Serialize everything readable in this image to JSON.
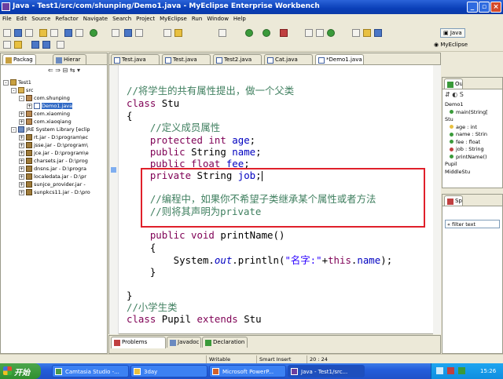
{
  "window": {
    "title": "Java - Test1/src/com/shunping/Demo1.java - MyEclipse Enterprise Workbench"
  },
  "menu": [
    "File",
    "Edit",
    "Source",
    "Refactor",
    "Navigate",
    "Search",
    "Project",
    "MyEclipse",
    "Run",
    "Window",
    "Help"
  ],
  "perspectives": {
    "java": "Java",
    "myeclipse": "MyEclipse"
  },
  "left_tabs": {
    "package": "Packag",
    "hierarchy": "Hierar"
  },
  "tree": [
    {
      "label": "Test1",
      "indent": 0,
      "twisty": "-",
      "icon": "proj"
    },
    {
      "label": "src",
      "indent": 1,
      "twisty": "-",
      "icon": "src"
    },
    {
      "label": "com.shunping",
      "indent": 2,
      "twisty": "-",
      "icon": "pkg"
    },
    {
      "label": "Demo1.java",
      "indent": 3,
      "twisty": "+",
      "icon": "java",
      "selected": true
    },
    {
      "label": "com.xiaoming",
      "indent": 2,
      "twisty": "+",
      "icon": "pkg"
    },
    {
      "label": "com.xiaoqiang",
      "indent": 2,
      "twisty": "+",
      "icon": "pkg"
    },
    {
      "label": "JRE System Library [eclip",
      "indent": 1,
      "twisty": "-",
      "icon": "lib"
    },
    {
      "label": "rt.jar - D:\\program\\ec",
      "indent": 2,
      "twisty": "+",
      "icon": "jar"
    },
    {
      "label": "jsse.jar - D:\\program\\",
      "indent": 2,
      "twisty": "+",
      "icon": "jar"
    },
    {
      "label": "jce.jar - D:\\program\\e",
      "indent": 2,
      "twisty": "+",
      "icon": "jar"
    },
    {
      "label": "charsets.jar - D:\\prog",
      "indent": 2,
      "twisty": "+",
      "icon": "jar"
    },
    {
      "label": "dnsns.jar - D:\\progra",
      "indent": 2,
      "twisty": "+",
      "icon": "jar"
    },
    {
      "label": "localedata.jar - D:\\pr",
      "indent": 2,
      "twisty": "+",
      "icon": "jar"
    },
    {
      "label": "sunjce_provider.jar -",
      "indent": 2,
      "twisty": "+",
      "icon": "jar"
    },
    {
      "label": "sunpkcs11.jar - D:\\pro",
      "indent": 2,
      "twisty": "+",
      "icon": "jar"
    }
  ],
  "editor_tabs": [
    "Test.java",
    "Test.java",
    "Test2.java",
    "Cat.java",
    "*Demo1.java"
  ],
  "code": {
    "l1": "//将学生的共有属性提出，做一个父类",
    "l2_kw": "class",
    "l2_rest": " Stu",
    "l3": "{",
    "l4": "    //定义成员属性",
    "l5_kw": "    protected int",
    "l5_fd": " age",
    "l5_end": ";",
    "l6_kw": "    public",
    "l6_mid": " String",
    "l6_fd": " name",
    "l6_end": ";",
    "l7_kw": "    public float",
    "l7_fd": " fee",
    "l7_end": ";",
    "l8_kw": "    private",
    "l8_mid": " String",
    "l8_fd": " job",
    "l8_end": ";",
    "l9": "    //编程中，如果你不希望子类继承某个属性或者方法",
    "l10": "    //则将其声明为private",
    "l11_kw": "    public void",
    "l11_rest": " printName()",
    "l12": "    {",
    "l13_a": "        System.",
    "l13_out": "out",
    "l13_b": ".println(",
    "l13_str": "\"名字:\"",
    "l13_c": "+",
    "l13_this": "this",
    "l13_d": ".",
    "l13_name": "name",
    "l13_e": ");",
    "l14": "    }",
    "l15": "}",
    "l16": "//小学生类",
    "l17_kw": "class",
    "l17_mid": " Pupil ",
    "l17_kw2": "extends",
    "l17_rest": " Stu"
  },
  "outline": {
    "tab": "Ou",
    "items": [
      {
        "label": "Demo1",
        "level": 0,
        "dot": ""
      },
      {
        "label": "main(String[",
        "level": 1,
        "dot": "#3a9a3a"
      },
      {
        "label": "Stu",
        "level": 0,
        "dot": ""
      },
      {
        "label": "age : int",
        "level": 1,
        "dot": "#e8c040"
      },
      {
        "label": "name : Strin",
        "level": 1,
        "dot": "#3a9a3a"
      },
      {
        "label": "fee : float",
        "level": 1,
        "dot": "#3a9a3a"
      },
      {
        "label": "job : String",
        "level": 1,
        "dot": "#c04040"
      },
      {
        "label": "printName()",
        "level": 1,
        "dot": "#3a9a3a"
      },
      {
        "label": "Pupil",
        "level": 0,
        "dot": ""
      },
      {
        "label": "MiddleStu",
        "level": 0,
        "dot": ""
      }
    ]
  },
  "snippets": {
    "tab": "Sp",
    "filter": "« filter text"
  },
  "bottom_tabs": [
    "Problems",
    "Javadoc",
    "Declaration"
  ],
  "status": {
    "mode": "Writable",
    "insert": "Smart Insert",
    "position": "20 : 24"
  },
  "taskbar": {
    "start": "开始",
    "tasks": [
      "Camtasia Studio -...",
      "3day",
      "Microsoft PowerP...",
      "Java - Test1/src..."
    ],
    "clock": "15:26"
  },
  "colors": {
    "keyword": "#7f0055",
    "comment": "#3f7f5f",
    "field": "#0000c0",
    "string": "#2a00ff",
    "highlight_box": "#e0202a"
  }
}
